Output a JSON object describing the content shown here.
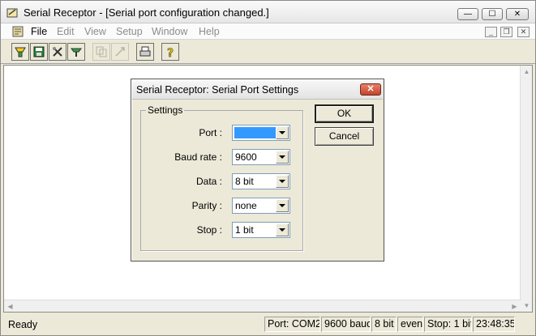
{
  "window": {
    "title": "Serial Receptor - [Serial port configuration changed.]",
    "min_glyph": "—",
    "max_glyph": "☐",
    "close_glyph": "✕"
  },
  "menubar": {
    "items": [
      "File",
      "Edit",
      "View",
      "Setup",
      "Window",
      "Help"
    ],
    "mdi_min": "_",
    "mdi_restore": "❐",
    "mdi_close": "✕"
  },
  "toolbar": {
    "buttons": [
      {
        "name": "connect-icon",
        "enabled": true
      },
      {
        "name": "save-icon",
        "enabled": true
      },
      {
        "name": "settings-tools-icon",
        "enabled": true
      },
      {
        "name": "send-icon",
        "enabled": true
      },
      {
        "name": "copy-icon",
        "enabled": false
      },
      {
        "name": "clear-icon",
        "enabled": false
      },
      {
        "name": "print-icon",
        "enabled": true
      },
      {
        "name": "help-icon",
        "enabled": true
      }
    ]
  },
  "dialog": {
    "title": "Serial Receptor: Serial Port Settings",
    "close_glyph": "✕",
    "group_label": "Settings",
    "fields": [
      {
        "label": "Port :",
        "value": "",
        "selected": true
      },
      {
        "label": "Baud rate :",
        "value": "9600"
      },
      {
        "label": "Data :",
        "value": "8 bit"
      },
      {
        "label": "Parity :",
        "value": "none"
      },
      {
        "label": "Stop :",
        "value": "1 bit"
      }
    ],
    "ok_label": "OK",
    "cancel_label": "Cancel"
  },
  "statusbar": {
    "ready": "Ready",
    "port": "Port: COM2",
    "baud": "9600 baud",
    "data": "8 bit",
    "parity": "even",
    "stop": "Stop: 1 bit",
    "time": "23:48:35"
  },
  "colors": {
    "selection": "#3399ff",
    "dialog_close": "#c4422a"
  }
}
